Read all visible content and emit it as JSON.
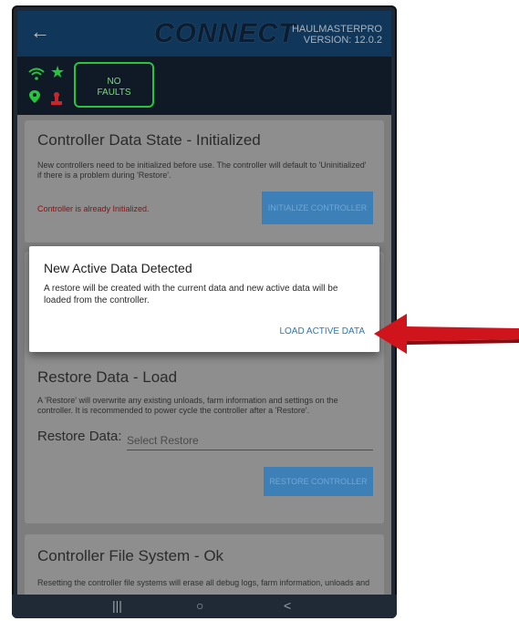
{
  "header": {
    "back_icon": "arrow-left-icon",
    "logo": "CONNECT",
    "app_name": "HAULMASTERPRO",
    "version": "VERSION: 12.0.2"
  },
  "status": {
    "faults_line1": "NO",
    "faults_line2": "FAULTS",
    "icons": [
      "wifi-icon",
      "star-icon",
      "location-pin-icon",
      "stamp-icon"
    ]
  },
  "card_init": {
    "title": "Controller Data State - Initialized",
    "desc": "New controllers need to be initialized before use. The controller will default to 'Uninitialized' if there is a problem during 'Restore'.",
    "warning": "Controller is already Initialized.",
    "button": "INITIALIZE CONTROLLER"
  },
  "card_restore": {
    "title": "Restore Data - Load",
    "desc": "A 'Restore' will overwrite any existing unloads, farm information and settings on the controller. It is recommended to power cycle the controller after a 'Restore'.",
    "field_label": "Restore Data:",
    "field_placeholder": "Select Restore",
    "button": "RESTORE CONTROLLER"
  },
  "card_fs": {
    "title": "Controller File System - Ok",
    "desc": "Resetting the controller file systems will erase all debug logs, farm information, unloads and"
  },
  "dialog": {
    "title": "New Active Data Detected",
    "text": "A restore will be created with the current data and new active data will be loaded from the controller.",
    "button": "LOAD ACTIVE DATA"
  },
  "navbar": {
    "recent": "|||",
    "home": "○",
    "back": "<"
  },
  "colors": {
    "header_bg": "#10375a",
    "accent_green": "#27c53e",
    "button_blue": "#3d80b8",
    "arrow_red": "#d0141b"
  }
}
